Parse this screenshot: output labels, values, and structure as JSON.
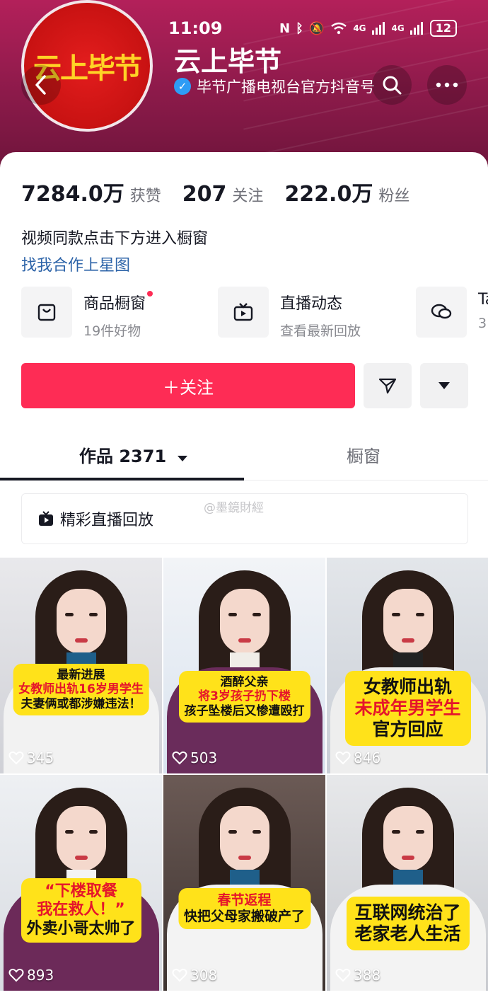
{
  "status_bar": {
    "time": "11:09",
    "signal1": "4G",
    "signal2": "4G",
    "battery": "12"
  },
  "profile": {
    "avatar_text": "云上毕节",
    "name": "云上毕节",
    "verified_text": "毕节广播电视台官方抖音号"
  },
  "stats": [
    {
      "num": "7284.0万",
      "label": "获赞"
    },
    {
      "num": "207",
      "label": "关注"
    },
    {
      "num": "222.0万",
      "label": "粉丝"
    }
  ],
  "bio": "视频同款点击下方进入橱窗",
  "link": "找我合作上星图",
  "features": [
    {
      "title": "商品橱窗",
      "sub": "19件好物",
      "icon": "shopping-bag-icon"
    },
    {
      "title": "直播动态",
      "sub": "查看最新回放",
      "icon": "live-tv-icon"
    },
    {
      "title": "Ta",
      "sub": "3",
      "icon": "chat-bubbles-icon"
    }
  ],
  "actions": {
    "follow_label": "＋关注"
  },
  "tabs": {
    "works": "作品 2371",
    "showcase": "橱窗"
  },
  "replay": {
    "label": "精彩直播回放",
    "watermark": "@墨鏡財經"
  },
  "videos": [
    {
      "lines": [
        "最新进展",
        "女教师出轨16岁男学生",
        "夫妻俩或都涉嫌违法！"
      ],
      "red_line": 1,
      "likes": "345"
    },
    {
      "lines": [
        "酒醉父亲",
        "将3岁孩子扔下楼",
        "孩子坠楼后又惨遭殴打"
      ],
      "red_line": 1,
      "likes": "503"
    },
    {
      "lines": [
        "女教师出轨",
        "未成年男学生",
        "官方回应"
      ],
      "red_line": 1,
      "likes": "846"
    },
    {
      "lines": [
        "“下楼取餐",
        "我在救人！”",
        "外卖小哥太帅了"
      ],
      "red_line": 0,
      "likes": "893"
    },
    {
      "lines": [
        "春节返程",
        "快把父母家搬破产了"
      ],
      "red_line": 0,
      "likes": "308"
    },
    {
      "lines": [
        "互联网统治了",
        "老家老人生活"
      ],
      "red_line": -1,
      "likes": "388"
    }
  ],
  "colors": {
    "accent": "#fe2c55",
    "banner": "#8c1a4a",
    "link": "#2c63a8",
    "caption_bg": "#ffe21a"
  }
}
